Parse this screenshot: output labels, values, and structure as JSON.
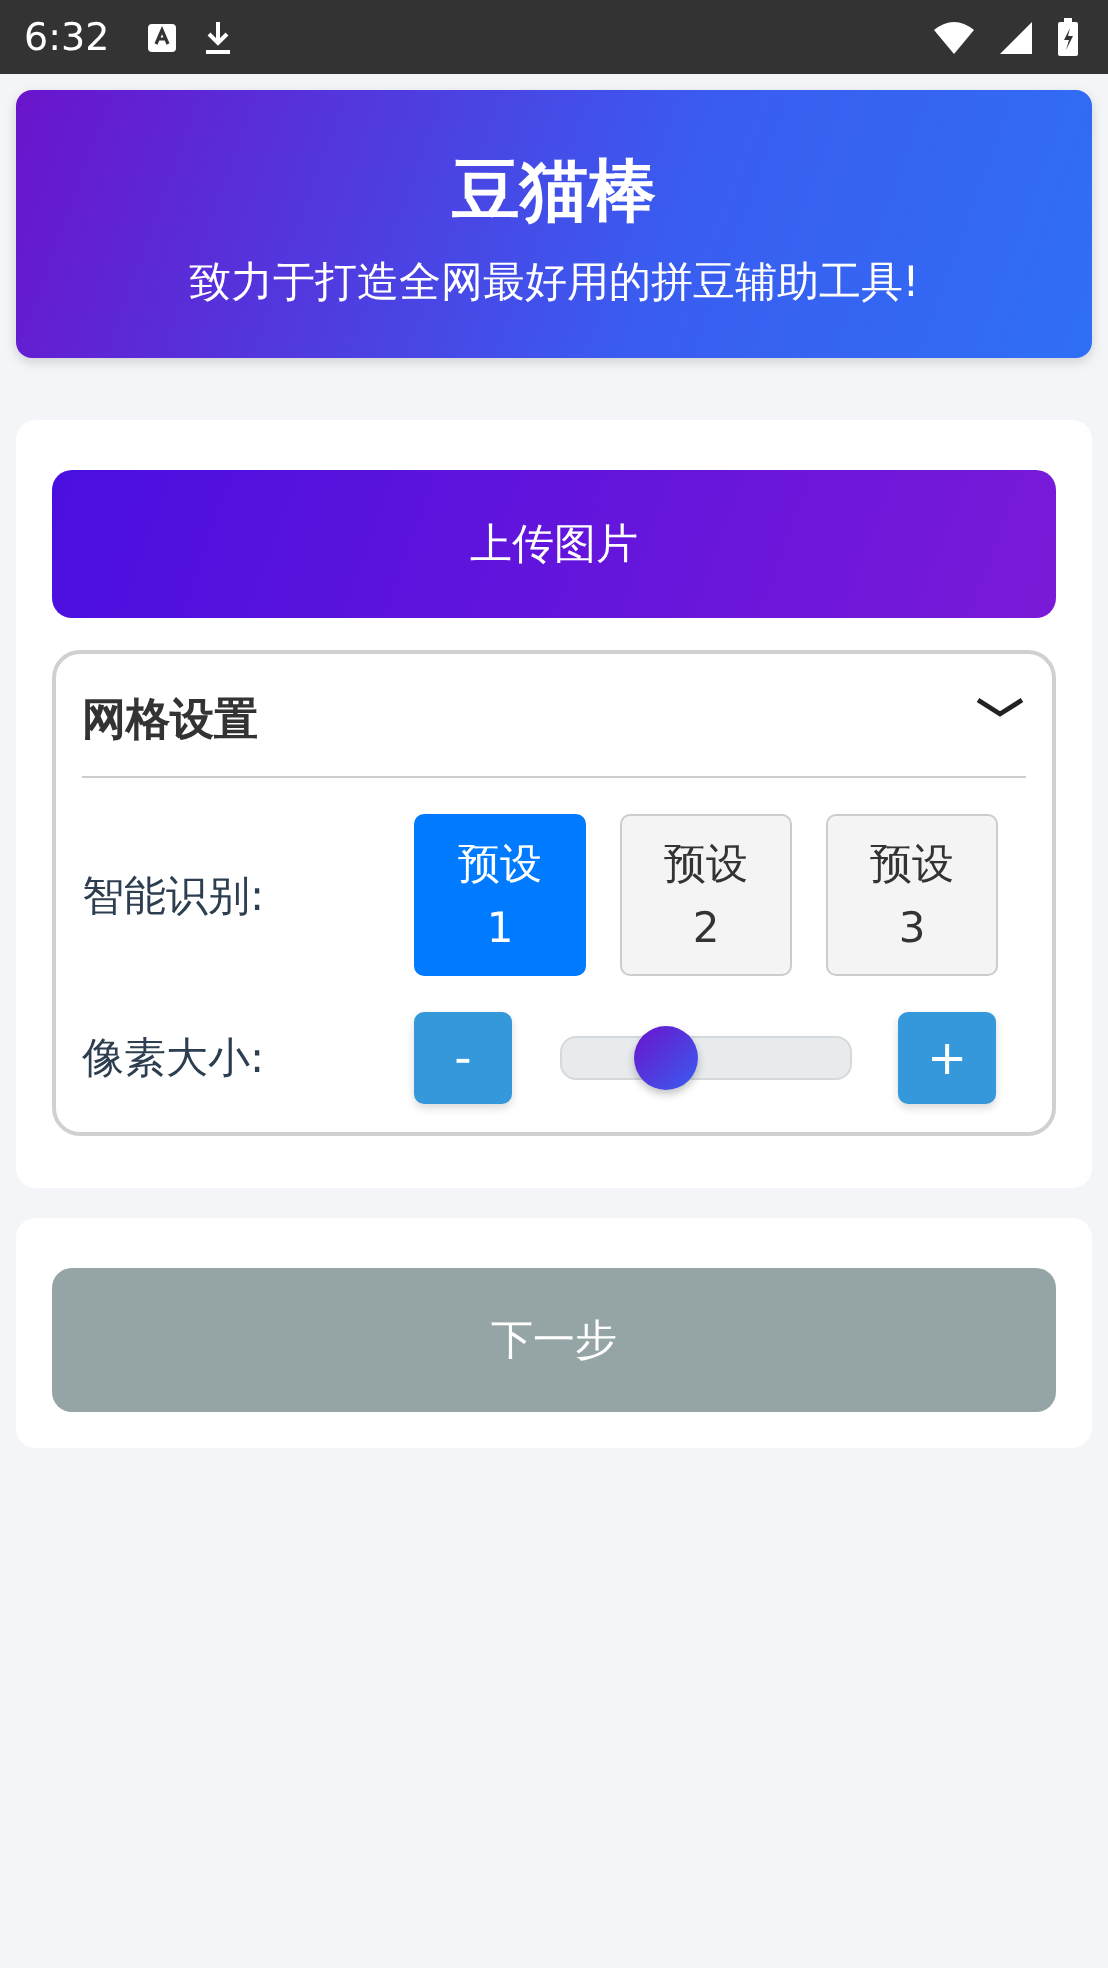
{
  "status_bar": {
    "time": "6:32"
  },
  "header": {
    "title": "豆猫棒",
    "subtitle": "致力于打造全网最好用的拼豆辅助工具!"
  },
  "upload_button": "上传图片",
  "grid_settings": {
    "title": "网格设置",
    "expanded": true,
    "recognition": {
      "label": "智能识别:",
      "presets": [
        {
          "label": "预设 1",
          "selected": true
        },
        {
          "label": "预设 2",
          "selected": false
        },
        {
          "label": "预设 3",
          "selected": false
        }
      ]
    },
    "pixel_size": {
      "label": "像素大小:",
      "minus": "-",
      "plus": "+",
      "level": 0.33
    }
  },
  "next_button": "下一步"
}
